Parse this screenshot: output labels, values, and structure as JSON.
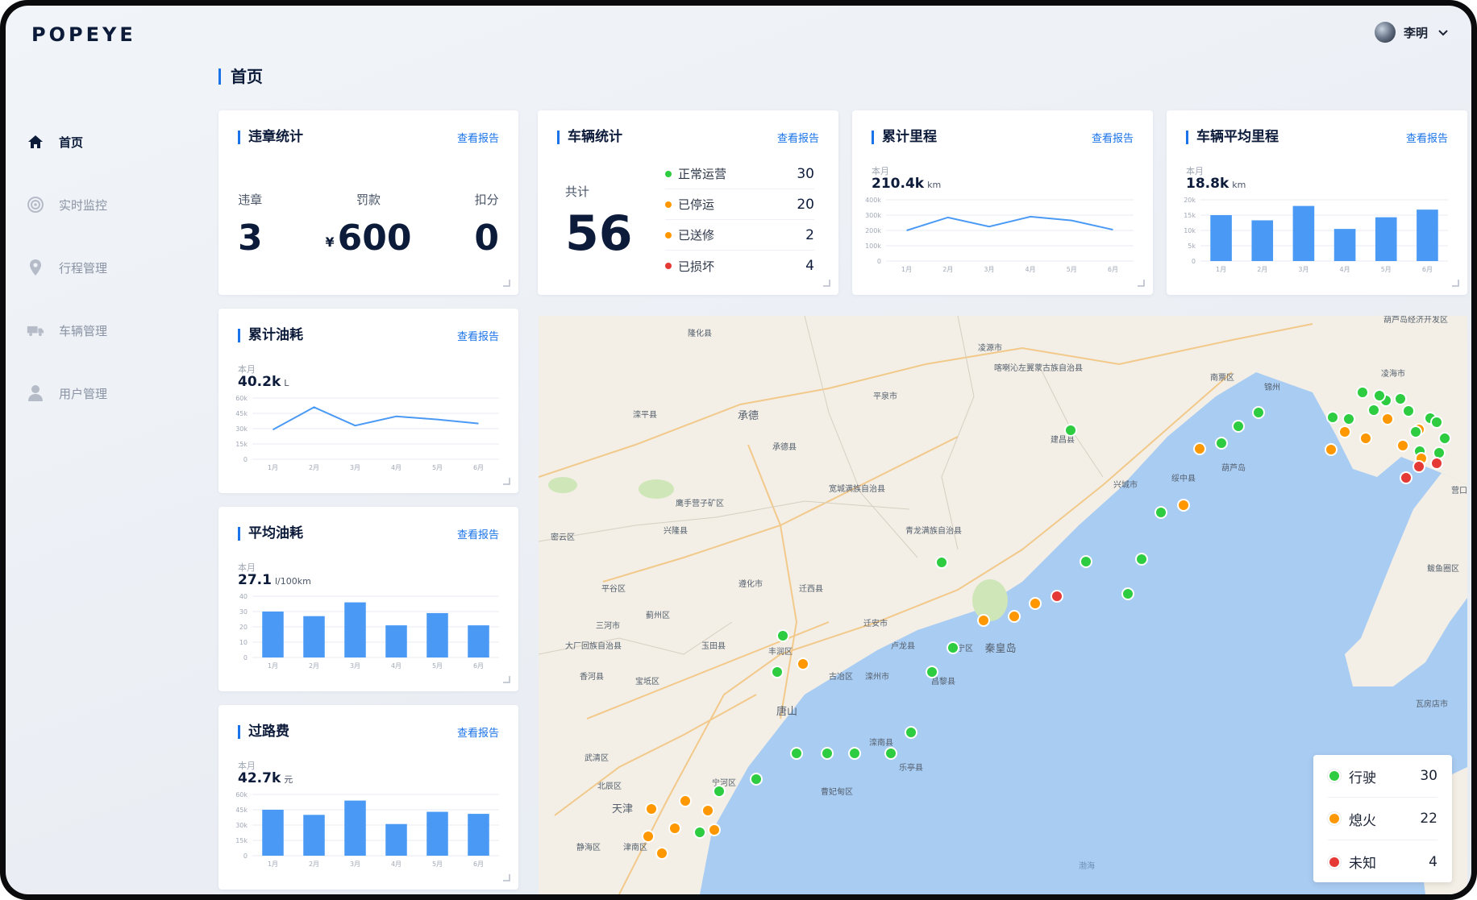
{
  "brand": {
    "logo": "POPEYE"
  },
  "user": {
    "name": "李明"
  },
  "sidebar": {
    "items": [
      {
        "label": "首页",
        "icon": "home-icon"
      },
      {
        "label": "实时监控",
        "icon": "monitor-icon"
      },
      {
        "label": "行程管理",
        "icon": "location-pin-icon"
      },
      {
        "label": "车辆管理",
        "icon": "truck-icon"
      },
      {
        "label": "用户管理",
        "icon": "user-icon"
      }
    ]
  },
  "page": {
    "title": "首页"
  },
  "common": {
    "report_link": "查看报告"
  },
  "violations": {
    "title": "违章统计",
    "items": [
      {
        "label": "违章",
        "value": "3"
      },
      {
        "label": "罚款",
        "currency": "¥",
        "value": "600"
      },
      {
        "label": "扣分",
        "value": "0"
      }
    ]
  },
  "vehicles": {
    "title": "车辆统计",
    "total_label": "共计",
    "total": "56",
    "statuses": [
      {
        "label": "正常运营",
        "value": "30",
        "color": "#2ecc40"
      },
      {
        "label": "已停运",
        "value": "20",
        "color": "#ff9800"
      },
      {
        "label": "已送修",
        "value": "2",
        "color": "#ff9800"
      },
      {
        "label": "已损坏",
        "value": "4",
        "color": "#e53935"
      }
    ]
  },
  "mileage": {
    "title": "累计里程",
    "period": "本月",
    "value": "210.4k",
    "unit": "km",
    "chart_data": {
      "type": "line",
      "categories": [
        "1月",
        "2月",
        "3月",
        "4月",
        "5月",
        "6月"
      ],
      "values": [
        200,
        285,
        225,
        290,
        265,
        205
      ],
      "yticks": [
        "400k",
        "300k",
        "200k",
        "100k",
        "0"
      ],
      "ylim": [
        0,
        400
      ]
    }
  },
  "avg_mileage": {
    "title": "车辆平均里程",
    "period": "本月",
    "value": "18.8k",
    "unit": "km",
    "chart_data": {
      "type": "bar",
      "categories": [
        "1月",
        "2月",
        "3月",
        "4月",
        "5月",
        "6月"
      ],
      "values": [
        15,
        13.3,
        18,
        10.5,
        14.3,
        16.8
      ],
      "yticks": [
        "20k",
        "15k",
        "10k",
        "5k",
        "0"
      ],
      "ylim": [
        0,
        20
      ]
    }
  },
  "fuel": {
    "title": "累计油耗",
    "period": "本月",
    "value": "40.2k",
    "unit": "L",
    "chart_data": {
      "type": "line",
      "categories": [
        "1月",
        "2月",
        "3月",
        "4月",
        "5月",
        "6月"
      ],
      "values": [
        29,
        51,
        33,
        42,
        39,
        35
      ],
      "yticks": [
        "60k",
        "45k",
        "30k",
        "15k",
        "0"
      ],
      "ylim": [
        0,
        60
      ]
    }
  },
  "avg_fuel": {
    "title": "平均油耗",
    "period": "本月",
    "value": "27.1",
    "unit": "l/100km",
    "chart_data": {
      "type": "bar",
      "categories": [
        "1月",
        "2月",
        "3月",
        "4月",
        "5月",
        "6月"
      ],
      "values": [
        30,
        27,
        36,
        21,
        29,
        21
      ],
      "yticks": [
        "40",
        "30",
        "20",
        "10",
        "0"
      ],
      "ylim": [
        0,
        40
      ]
    }
  },
  "tolls": {
    "title": "过路费",
    "period": "本月",
    "value": "42.7k",
    "unit": "元",
    "chart_data": {
      "type": "bar",
      "categories": [
        "1月",
        "2月",
        "3月",
        "4月",
        "5月",
        "6月"
      ],
      "values": [
        45,
        40,
        54,
        31,
        43,
        41
      ],
      "yticks": [
        "60k",
        "45k",
        "30k",
        "15k",
        "0"
      ],
      "ylim": [
        0,
        60
      ]
    }
  },
  "map": {
    "labels": [
      {
        "text": "隆化县"
      },
      {
        "text": "凌源市"
      },
      {
        "text": "喀喇沁左翼蒙古族自治县"
      },
      {
        "text": "南票区"
      },
      {
        "text": "平泉市"
      },
      {
        "text": "承德"
      },
      {
        "text": "滦平县"
      },
      {
        "text": "承德县"
      },
      {
        "text": "宽城满族自治县"
      },
      {
        "text": "建昌县"
      },
      {
        "text": "葫芦岛"
      },
      {
        "text": "锦州"
      },
      {
        "text": "营口"
      },
      {
        "text": "鲅鱼圈区"
      },
      {
        "text": "瓦房店市"
      },
      {
        "text": "绥中县"
      },
      {
        "text": "青龙满族自治县"
      },
      {
        "text": "兴隆县"
      },
      {
        "text": "鹰手营子矿区"
      },
      {
        "text": "密云区"
      },
      {
        "text": "平谷区"
      },
      {
        "text": "遵化市"
      },
      {
        "text": "迁西县"
      },
      {
        "text": "迁安市"
      },
      {
        "text": "卢龙县"
      },
      {
        "text": "抚宁区"
      },
      {
        "text": "秦皇岛"
      },
      {
        "text": "三河市"
      },
      {
        "text": "玉田县"
      },
      {
        "text": "唐山"
      },
      {
        "text": "古冶区"
      },
      {
        "text": "滦州市"
      },
      {
        "text": "昌黎县"
      },
      {
        "text": "宝坻区"
      },
      {
        "text": "香河县"
      },
      {
        "text": "滦南县"
      },
      {
        "text": "乐亭县"
      },
      {
        "text": "曹妃甸区"
      },
      {
        "text": "宁河区"
      },
      {
        "text": "天津"
      },
      {
        "text": "北辰区"
      },
      {
        "text": "武清区"
      },
      {
        "text": "静海区"
      },
      {
        "text": "津南区"
      },
      {
        "text": "渤海"
      },
      {
        "text": "兴城市"
      },
      {
        "text": "葫芦岛经济开发区"
      },
      {
        "text": "凌海市"
      },
      {
        "text": "大厂回族自治县"
      },
      {
        "text": "蓟州区"
      },
      {
        "text": "丰润区"
      }
    ],
    "legend": [
      {
        "label": "行驶",
        "value": "30",
        "color": "#2ecc40"
      },
      {
        "label": "熄火",
        "value": "22",
        "color": "#ff9800"
      },
      {
        "label": "未知",
        "value": "4",
        "color": "#e53935"
      }
    ]
  }
}
